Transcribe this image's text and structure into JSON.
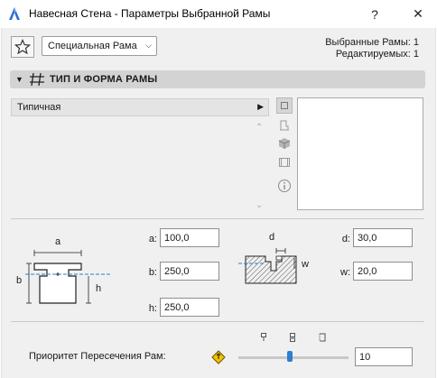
{
  "window": {
    "title": "Навесная Стена - Параметры Выбранной Рамы",
    "help_label": "?",
    "close_label": "✕"
  },
  "toolbar": {
    "favorites_icon": "star-icon",
    "frame_type_value": "Специальная Рама",
    "selected_label": "Выбранные Рамы: 1",
    "editable_label": "Редактируемых: 1"
  },
  "section": {
    "title": "ТИП И ФОРМА РАМЫ",
    "icon": "frame-icon"
  },
  "frame_style": {
    "value": "Типичная"
  },
  "side_icons": [
    "square-icon",
    "profile-icon",
    "cube-icon",
    "film-icon",
    "info-icon"
  ],
  "dimensions": {
    "left_diagram": {
      "label_a": "a",
      "label_b": "b",
      "label_h": "h"
    },
    "right_diagram": {
      "label_d": "d",
      "label_w": "w"
    },
    "a": {
      "label": "a:",
      "value": "100,0"
    },
    "b": {
      "label": "b:",
      "value": "250,0"
    },
    "h": {
      "label": "h:",
      "value": "250,0"
    },
    "d": {
      "label": "d:",
      "value": "30,0"
    },
    "w": {
      "label": "w:",
      "value": "20,0"
    }
  },
  "priority": {
    "label": "Приоритет Пересечения Рам:",
    "value": "10",
    "slider_fraction": 0.47
  }
}
